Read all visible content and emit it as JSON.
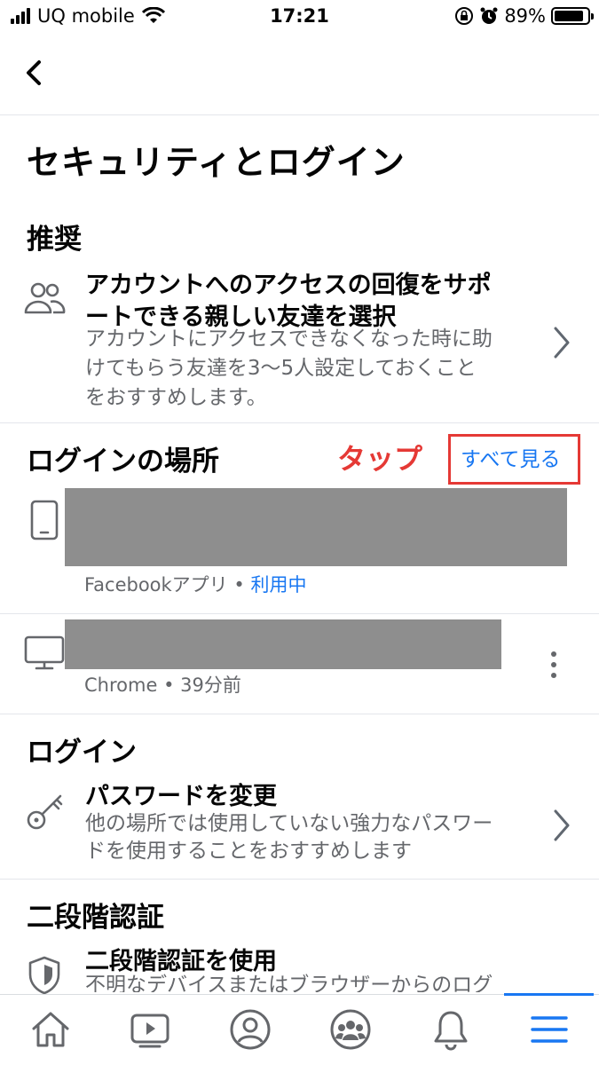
{
  "status_bar": {
    "carrier": "UQ mobile",
    "time": "17:21",
    "battery_percent": "89%",
    "battery_level": 0.89
  },
  "page": {
    "title": "セキュリティとログイン"
  },
  "recommended": {
    "section_title": "推奨",
    "item": {
      "icon": "people-icon",
      "title_line1": "アカウントへのアクセスの回復をサポ",
      "title_line2": "ートできる親しい友達を選択",
      "desc_line1": "アカウントにアクセスできなくなった時に助",
      "desc_line2": "けてもらう友達を3〜5人設定しておくこと",
      "desc_line3": "をおすすめします。"
    }
  },
  "login_locations": {
    "section_title": "ログインの場所",
    "annotation": "タップ",
    "see_all_label": "すべて見る",
    "sessions": [
      {
        "icon": "smartphone-icon",
        "app": "Facebookアプリ",
        "separator": "•",
        "status": "利用中"
      },
      {
        "icon": "desktop-icon",
        "app": "Chrome",
        "separator": "•",
        "status": "39分前"
      }
    ]
  },
  "login": {
    "section_title": "ログイン",
    "item": {
      "icon": "key-icon",
      "title": "パスワードを変更",
      "desc_line1": "他の場所では使用していない強力なパスワー",
      "desc_line2": "ドを使用することをおすすめします"
    }
  },
  "two_factor": {
    "section_title": "二段階認証",
    "item": {
      "icon": "shield-icon",
      "title": "二段階認証を使用",
      "desc_line1": "不明なデバイスまたはブラウザーからのログ"
    }
  },
  "tab_bar": {
    "tabs": [
      "home-icon",
      "video-icon",
      "profile-icon",
      "groups-icon",
      "bell-icon",
      "menu-icon"
    ],
    "active_tab": "menu-icon"
  },
  "colors": {
    "accent": "#1877f2",
    "annotation": "#e53935",
    "secondary_text": "#65676b",
    "redaction": "#8e8e8e"
  }
}
